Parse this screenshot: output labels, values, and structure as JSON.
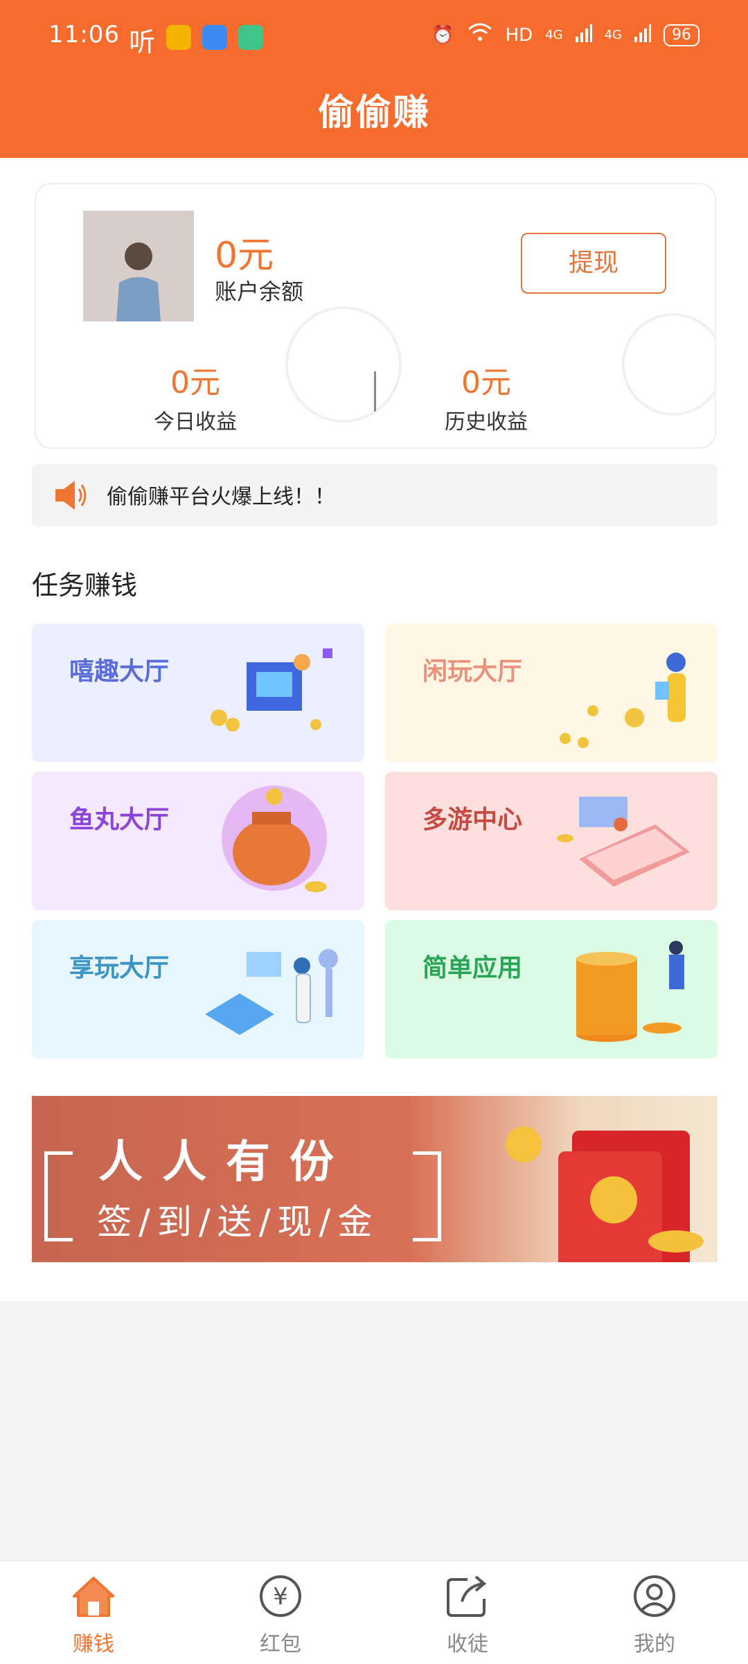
{
  "status_bar": {
    "time": "11:06",
    "ting": "听",
    "network": "HD",
    "signal1": "4G",
    "signal2": "4G",
    "battery": "96"
  },
  "header": {
    "title": "偷偷赚"
  },
  "account": {
    "balance_amount": "0元",
    "balance_label": "账户余额",
    "withdraw_label": "提现",
    "today_amount": "0元",
    "today_label": "今日收益",
    "history_amount": "0元",
    "history_label": "历史收益"
  },
  "notice": {
    "text": "偷偷赚平台火爆上线！！"
  },
  "tasks": {
    "section_title": "任务赚钱",
    "items": [
      {
        "label": "嘻趣大厅"
      },
      {
        "label": "闲玩大厅"
      },
      {
        "label": "鱼丸大厅"
      },
      {
        "label": "多游中心"
      },
      {
        "label": "享玩大厅"
      },
      {
        "label": "简单应用"
      }
    ]
  },
  "banner": {
    "line1": "人人有份",
    "line2": "签/到/送/现/金"
  },
  "bottom_nav": {
    "items": [
      {
        "label": "赚钱",
        "icon": "home-icon"
      },
      {
        "label": "红包",
        "icon": "yuan-icon"
      },
      {
        "label": "收徒",
        "icon": "share-icon"
      },
      {
        "label": "我的",
        "icon": "user-icon"
      }
    ]
  },
  "colors": {
    "brand": "#f76b2c",
    "accent_text": "#f07530",
    "nav_active": "#f07530",
    "nav_inactive": "#888888"
  }
}
